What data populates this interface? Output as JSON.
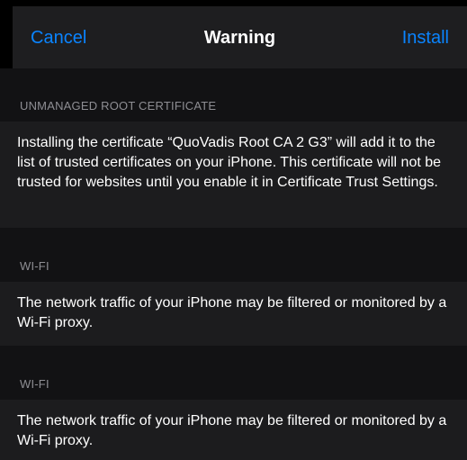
{
  "nav": {
    "cancel_label": "Cancel",
    "title": "Warning",
    "install_label": "Install"
  },
  "sections": [
    {
      "header": "UNMANAGED ROOT CERTIFICATE",
      "body": "Installing the certificate “QuoVadis Root CA 2 G3” will add it to the list of trusted certificates on your iPhone. This certificate will not be trusted for websites until you enable it in Certificate Trust Settings."
    },
    {
      "header": "WI-FI",
      "body": "The network traffic of your iPhone may be filtered or monitored by a Wi-Fi proxy."
    },
    {
      "header": "WI-FI",
      "body": "The network traffic of your iPhone may be filtered or monitored by a Wi-Fi proxy."
    }
  ],
  "colors": {
    "accent": "#0a84ff",
    "nav_background": "#1e1e20",
    "group_background": "#121214",
    "cell_background": "#1c1c1e",
    "header_text": "#8e8e93"
  }
}
